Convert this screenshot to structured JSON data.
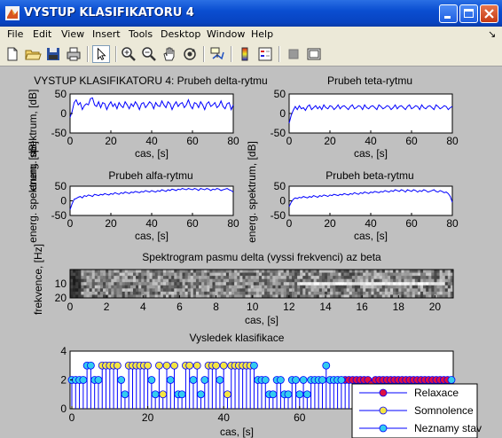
{
  "window": {
    "title": "VYSTUP KLASIFIKATORU 4",
    "menu": [
      "File",
      "Edit",
      "View",
      "Insert",
      "Tools",
      "Desktop",
      "Window",
      "Help"
    ],
    "dock_arrow": "↘",
    "toolbar_icons": [
      "new-file-icon",
      "open-folder-icon",
      "save-icon",
      "print-icon",
      "pointer-icon",
      "zoom-in-icon",
      "zoom-out-icon",
      "pan-hand-icon",
      "rotate-3d-icon",
      "data-cursor-icon",
      "colorbar-icon",
      "legend-icon",
      "hide-plot-tools-icon",
      "show-plot-tools-icon"
    ]
  },
  "chart_data": [
    {
      "type": "line",
      "title": "VYSTUP KLASIFIKATORU 4: Prubeh delta-rytmu",
      "xlabel": "cas, [s]",
      "ylabel": "energ. spektrum, [dB]",
      "xlim": [
        0,
        80
      ],
      "ylim": [
        -50,
        50
      ],
      "xticks": [
        "0",
        "20",
        "40",
        "60",
        "80"
      ],
      "yticks": [
        "50",
        "0",
        "-50"
      ],
      "series": [
        {
          "color": "#0000ff",
          "x_step": 1,
          "values": [
            -10,
            5,
            28,
            35,
            22,
            28,
            10,
            20,
            25,
            22,
            38,
            40,
            22,
            18,
            30,
            15,
            28,
            25,
            10,
            22,
            30,
            18,
            25,
            12,
            28,
            20,
            15,
            30,
            22,
            12,
            25,
            18,
            30,
            22,
            10,
            25,
            28,
            15,
            22,
            30,
            25,
            12,
            28,
            20,
            18,
            32,
            22,
            15,
            30,
            25,
            10,
            22,
            30,
            18,
            25,
            28,
            15,
            22,
            35,
            20,
            12,
            28,
            25,
            15,
            30,
            22,
            10,
            25,
            30,
            18,
            22,
            28,
            15,
            20,
            32,
            18,
            12,
            25,
            28,
            10,
            22
          ]
        }
      ]
    },
    {
      "type": "line",
      "title": "Prubeh teta-rytmu",
      "xlabel": "cas, [s]",
      "ylabel": "",
      "xlim": [
        0,
        80
      ],
      "ylim": [
        -50,
        50
      ],
      "xticks": [
        "0",
        "20",
        "40",
        "60",
        "80"
      ],
      "yticks": [
        "50",
        "0",
        "-50"
      ],
      "series": [
        {
          "color": "#0000ff",
          "x_step": 1,
          "values": [
            -25,
            -5,
            8,
            18,
            10,
            20,
            12,
            15,
            8,
            18,
            22,
            10,
            15,
            20,
            12,
            18,
            10,
            22,
            15,
            12,
            20,
            18,
            10,
            15,
            22,
            12,
            18,
            20,
            15,
            10,
            18,
            22,
            12,
            15,
            20,
            18,
            10,
            22,
            15,
            12,
            18,
            20,
            15,
            10,
            22,
            18,
            12,
            15,
            20,
            18,
            10,
            15,
            22,
            12,
            18,
            20,
            15,
            10,
            18,
            22,
            12,
            15,
            20,
            18,
            10,
            22,
            15,
            12,
            18,
            20,
            15,
            10,
            22,
            18,
            12,
            15,
            20,
            18,
            10,
            15,
            18
          ]
        }
      ]
    },
    {
      "type": "line",
      "title": "Prubeh alfa-rytmu",
      "xlabel": "cas, [s]",
      "ylabel": "energ. spektrum, [dB]",
      "xlim": [
        0,
        80
      ],
      "ylim": [
        -50,
        50
      ],
      "xticks": [
        "0",
        "20",
        "40",
        "60",
        "80"
      ],
      "yticks": [
        "50",
        "0",
        "-50"
      ],
      "series": [
        {
          "color": "#0000ff",
          "x_step": 1,
          "values": [
            -30,
            -10,
            5,
            8,
            12,
            15,
            10,
            18,
            15,
            20,
            18,
            15,
            22,
            20,
            18,
            22,
            20,
            25,
            22,
            20,
            25,
            22,
            28,
            25,
            22,
            28,
            25,
            30,
            28,
            25,
            30,
            28,
            32,
            30,
            28,
            32,
            30,
            35,
            32,
            30,
            35,
            32,
            30,
            35,
            32,
            38,
            35,
            32,
            38,
            35,
            40,
            38,
            35,
            40,
            38,
            42,
            40,
            38,
            42,
            40,
            38,
            42,
            40,
            35,
            42,
            40,
            38,
            42,
            40,
            35,
            40,
            38,
            42,
            40,
            35,
            38,
            40,
            42,
            38,
            35,
            30
          ]
        }
      ]
    },
    {
      "type": "line",
      "title": "Prubeh beta-rytmu",
      "xlabel": "cas, [s]",
      "ylabel": "energ. spektrum, [dB]",
      "xlim": [
        0,
        80
      ],
      "ylim": [
        -50,
        50
      ],
      "xticks": [
        "0",
        "20",
        "40",
        "60",
        "80"
      ],
      "yticks": [
        "50",
        "0",
        "-50"
      ],
      "series": [
        {
          "color": "#0000ff",
          "x_step": 1,
          "values": [
            -20,
            -5,
            5,
            10,
            8,
            12,
            10,
            15,
            12,
            10,
            15,
            12,
            18,
            15,
            12,
            18,
            15,
            20,
            18,
            15,
            20,
            18,
            22,
            20,
            18,
            22,
            20,
            25,
            22,
            20,
            25,
            22,
            28,
            25,
            22,
            28,
            25,
            30,
            28,
            25,
            30,
            28,
            32,
            30,
            28,
            32,
            30,
            35,
            32,
            30,
            35,
            32,
            38,
            35,
            32,
            38,
            35,
            30,
            38,
            35,
            32,
            38,
            35,
            30,
            35,
            32,
            38,
            35,
            30,
            32,
            35,
            38,
            32,
            30,
            35,
            32,
            28,
            30,
            25,
            15,
            -5
          ]
        }
      ]
    },
    {
      "type": "heatmap",
      "title": "Spektrogram pasmu delta (vyssi frekvenci) az beta",
      "xlabel": "cas, [s]",
      "ylabel": "frekvence, [Hz]",
      "xlim": [
        0,
        21
      ],
      "ylim": [
        0,
        20
      ],
      "xticks": [
        "0",
        "2",
        "4",
        "6",
        "8",
        "10",
        "12",
        "14",
        "16",
        "18",
        "20"
      ],
      "yticks": [
        "10",
        "20"
      ],
      "columns": 140,
      "rows": 9,
      "highlight_band": {
        "row": 4,
        "from_x": 12.5,
        "to_x": 20.5
      }
    },
    {
      "type": "scatter",
      "title": "Vysledek klasifikace",
      "xlabel": "cas, [s]",
      "ylabel": "",
      "xlim": [
        0,
        100
      ],
      "ylim": [
        0,
        4
      ],
      "xticks": [
        "0",
        "20",
        "40",
        "60",
        "80"
      ],
      "yticks": [
        "4",
        "2",
        "0"
      ],
      "series": [
        {
          "name": "Relaxace",
          "marker_color": "#dd1144",
          "x": [
            72,
            73,
            74,
            75,
            76,
            77,
            78,
            79,
            80,
            81,
            82,
            83,
            84,
            85,
            86,
            87,
            88,
            89,
            90,
            91,
            92,
            93,
            94,
            95,
            96,
            97,
            98,
            99
          ],
          "values": [
            2,
            2,
            2,
            2,
            2,
            2,
            2,
            1.7,
            2,
            2,
            2,
            2,
            2,
            2,
            2,
            2,
            2,
            2,
            2,
            2,
            2,
            2,
            2,
            2,
            2,
            2,
            2,
            2
          ]
        },
        {
          "name": "Somnolence",
          "marker_color": "#f5e642",
          "x": [
            8,
            9,
            10,
            11,
            12,
            15,
            16,
            17,
            18,
            19,
            20,
            23,
            24,
            25,
            27,
            30,
            31,
            33,
            36,
            37,
            38,
            40,
            41,
            42,
            43,
            44,
            45,
            46,
            47
          ],
          "values": [
            3,
            3,
            3,
            3,
            3,
            3,
            3,
            3,
            3,
            3,
            3,
            3,
            1,
            3,
            3,
            3,
            3,
            3,
            3,
            3,
            3,
            3,
            1,
            3,
            3,
            3,
            3,
            3,
            3
          ]
        },
        {
          "name": "Neznamy stav",
          "marker_color": "#33ccee",
          "x": [
            0,
            1,
            2,
            3,
            4,
            5,
            6,
            7,
            13,
            14,
            21,
            22,
            26,
            28,
            29,
            32,
            34,
            35,
            39,
            48,
            49,
            50,
            51,
            52,
            53,
            54,
            55,
            56,
            57,
            58,
            59,
            60,
            61,
            62,
            63,
            64,
            65,
            66,
            67,
            68,
            69,
            70,
            71,
            100
          ],
          "values": [
            2,
            2,
            2,
            2,
            3,
            3,
            2,
            2,
            2,
            1,
            2,
            1,
            2,
            1,
            1,
            2,
            1,
            2,
            2,
            3,
            2,
            2,
            2,
            1,
            1,
            2,
            2,
            1,
            1,
            2,
            2,
            1,
            2,
            1,
            2,
            2,
            2,
            2,
            3,
            2,
            2,
            2,
            2,
            2
          ]
        }
      ],
      "legend": "bottom-right"
    }
  ]
}
